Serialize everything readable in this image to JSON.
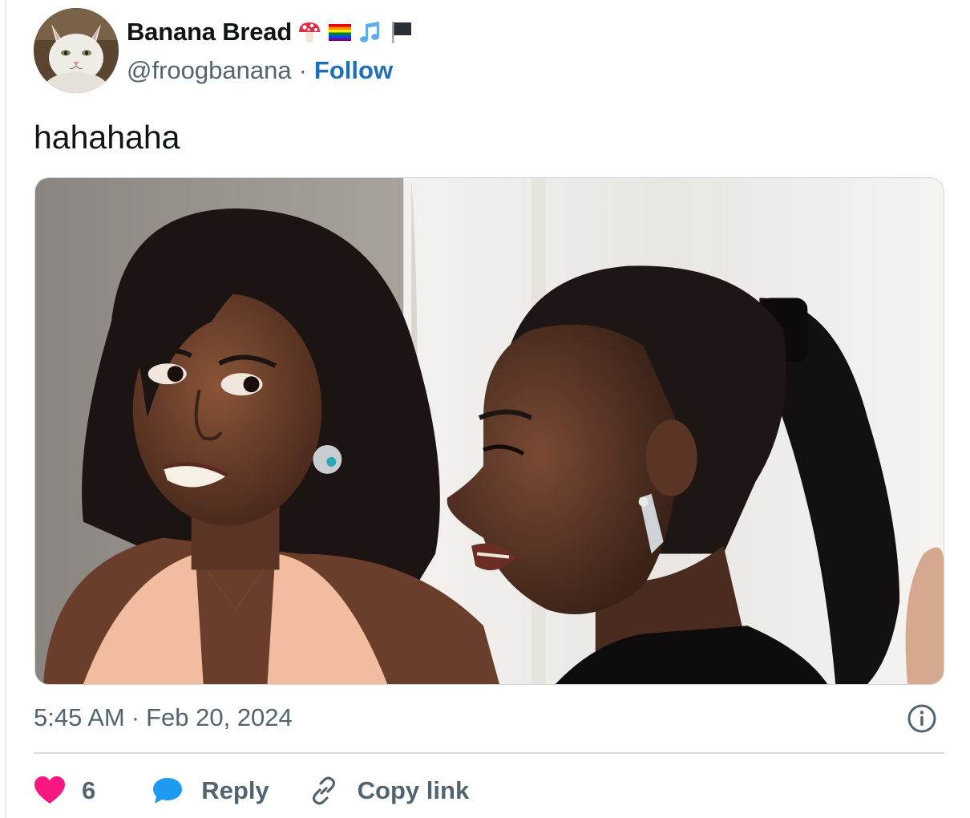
{
  "author": {
    "display_name": "Banana Bread",
    "name_emojis": [
      "mushroom-icon",
      "rainbow-flag-icon",
      "music-notes-icon",
      "black-flag-icon"
    ],
    "handle": "@froogbanana",
    "separator": "·",
    "follow_label": "Follow"
  },
  "tweet": {
    "text": "hahahaha",
    "media_alt": "photo"
  },
  "meta": {
    "time": "5:45 AM",
    "separator": "·",
    "date": "Feb 20, 2024"
  },
  "actions": {
    "like_count": "6",
    "reply_label": "Reply",
    "copy_link_label": "Copy link"
  },
  "colors": {
    "link_blue": "#1d70b8",
    "like_pink": "#f91880",
    "reply_blue": "#1d9bf0",
    "muted": "#536471"
  }
}
